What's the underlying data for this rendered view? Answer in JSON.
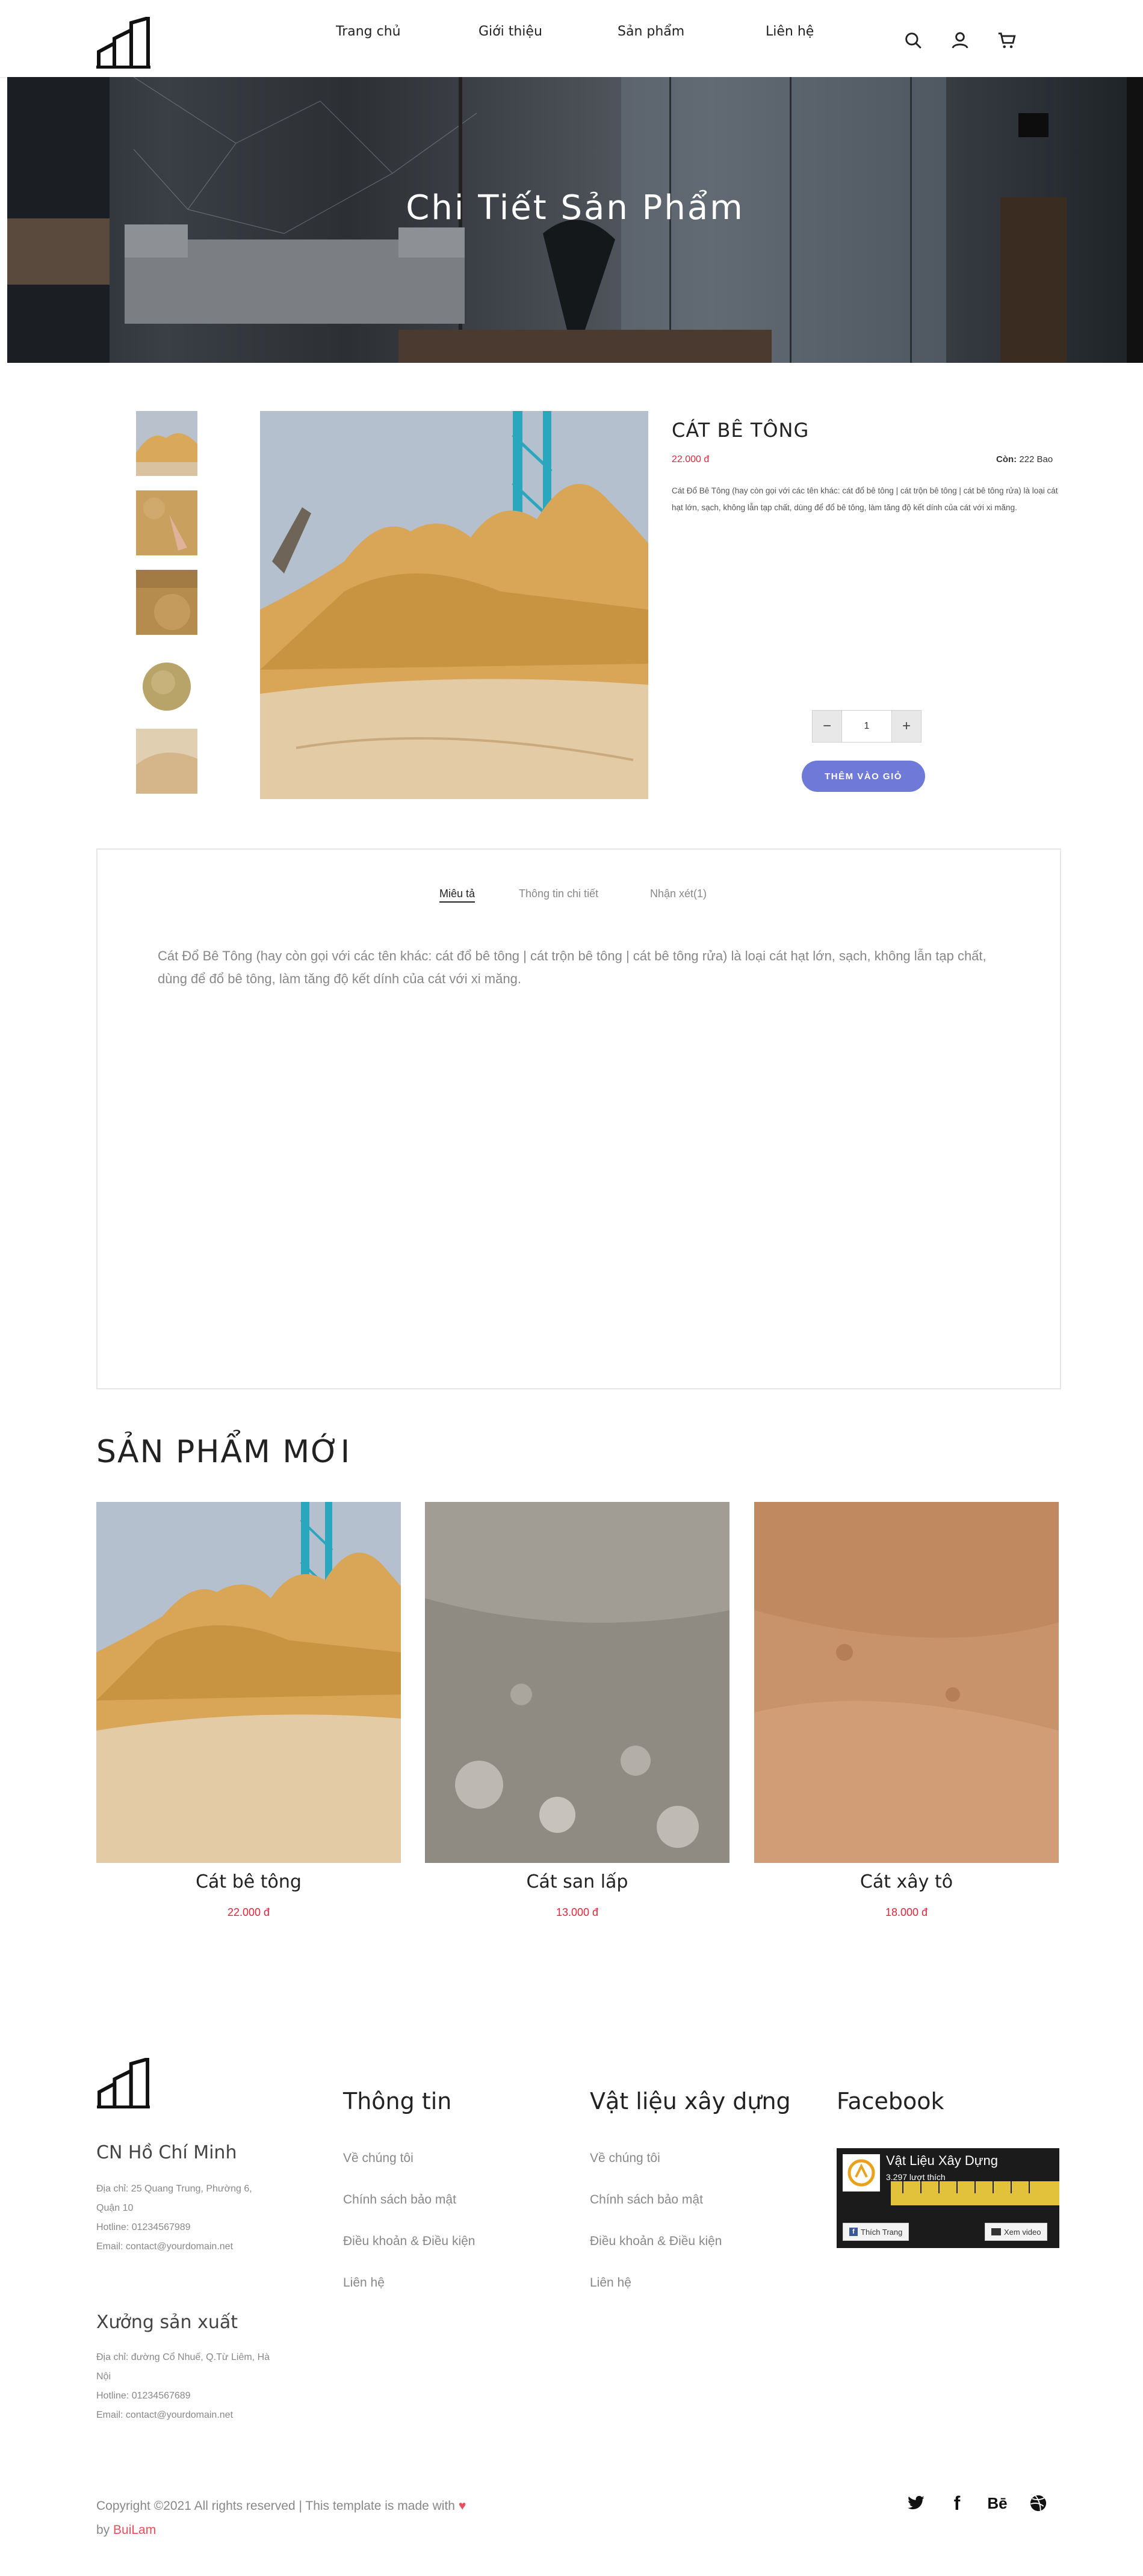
{
  "nav": {
    "items": [
      "Trang chủ",
      "Giới thiệu",
      "Sản phẩm",
      "Liên hệ"
    ]
  },
  "icons": {
    "search": "search-icon",
    "user": "user-icon",
    "cart": "cart-icon"
  },
  "hero": {
    "title": "Chi Tiết Sản Phẩm"
  },
  "product": {
    "title": "CÁT BÊ TÔNG",
    "price": "22.000 đ",
    "stock_label": "Còn:",
    "stock_value": " 222 Bao",
    "description": "Cát Đổ Bê Tông (hay còn gọi với các tên khác: cát đổ bê tông | cát trộn bê tông | cát bê tông rửa) là loại cát hạt lớn, sạch, không lẫn tạp chất, dùng để đổ bê tông, làm tăng độ kết dính của cát với xi măng.",
    "quantity": "1",
    "minus": "−",
    "plus": "+",
    "add_to_cart": "THÊM VÀO GIỎ"
  },
  "tabs": {
    "items": [
      "Miêu tả",
      "Thông tin chi tiết",
      "Nhận xét(1)"
    ],
    "active_index": 0,
    "body": "Cát Đổ Bê Tông (hay còn gọi với các tên khác: cát đổ bê tông | cát trộn bê tông | cát bê tông rửa) là loại cát hạt lớn, sạch, không lẫn tạp chất, dùng để đổ bê tông, làm tăng độ kết dính của cát với xi măng."
  },
  "new_products": {
    "title": "SẢN PHẨM MỚI",
    "items": [
      {
        "name": "Cát bê tông",
        "price": "22.000 đ"
      },
      {
        "name": "Cát san lấp",
        "price": "13.000 đ"
      },
      {
        "name": "Cát xây tô",
        "price": "18.000 đ"
      }
    ]
  },
  "footer": {
    "branches": [
      {
        "name": "CN Hồ Chí Minh",
        "lines": [
          "Địa chỉ: 25 Quang Trung, Phường 6,",
          "Quận 10",
          "Hotline: 01234567989",
          "Email: contact@yourdomain.net"
        ]
      },
      {
        "name": "Xưởng sản xuất",
        "lines": [
          "Địa chỉ: đường Cổ Nhuế, Q.Từ Liêm, Hà",
          "Nội",
          "Hotline: 01234567689",
          "Email: contact@yourdomain.net"
        ]
      }
    ],
    "columns": [
      {
        "title": "Thông tin",
        "links": [
          "Về chúng tôi",
          "Chính sách bảo mật",
          "Điều khoản & Điều kiện",
          "Liên hệ"
        ]
      },
      {
        "title": "Vật liệu xây dựng",
        "links": [
          "Về chúng tôi",
          "Chính sách bảo mật",
          "Điều khoản & Điều kiện",
          "Liên hệ"
        ]
      },
      {
        "title": "Facebook"
      }
    ],
    "facebook": {
      "page_name": "Vật Liệu Xây Dựng",
      "likes": "3.297 lượt thích",
      "like_button": "Thích Trang",
      "video_button": "Xem video"
    },
    "copyright_prefix": "Copyright ©2021 All rights reserved | This template is made with",
    "copyright_by": "by",
    "author": "BuiLam",
    "heart_color": "#e94e5b",
    "social": [
      "twitter-icon",
      "facebook-icon",
      "behance-icon",
      "dribbble-icon"
    ],
    "behance_text": "Bē"
  },
  "colors": {
    "accent_button": "#6f7ad8",
    "price_red": "#e0263a"
  }
}
